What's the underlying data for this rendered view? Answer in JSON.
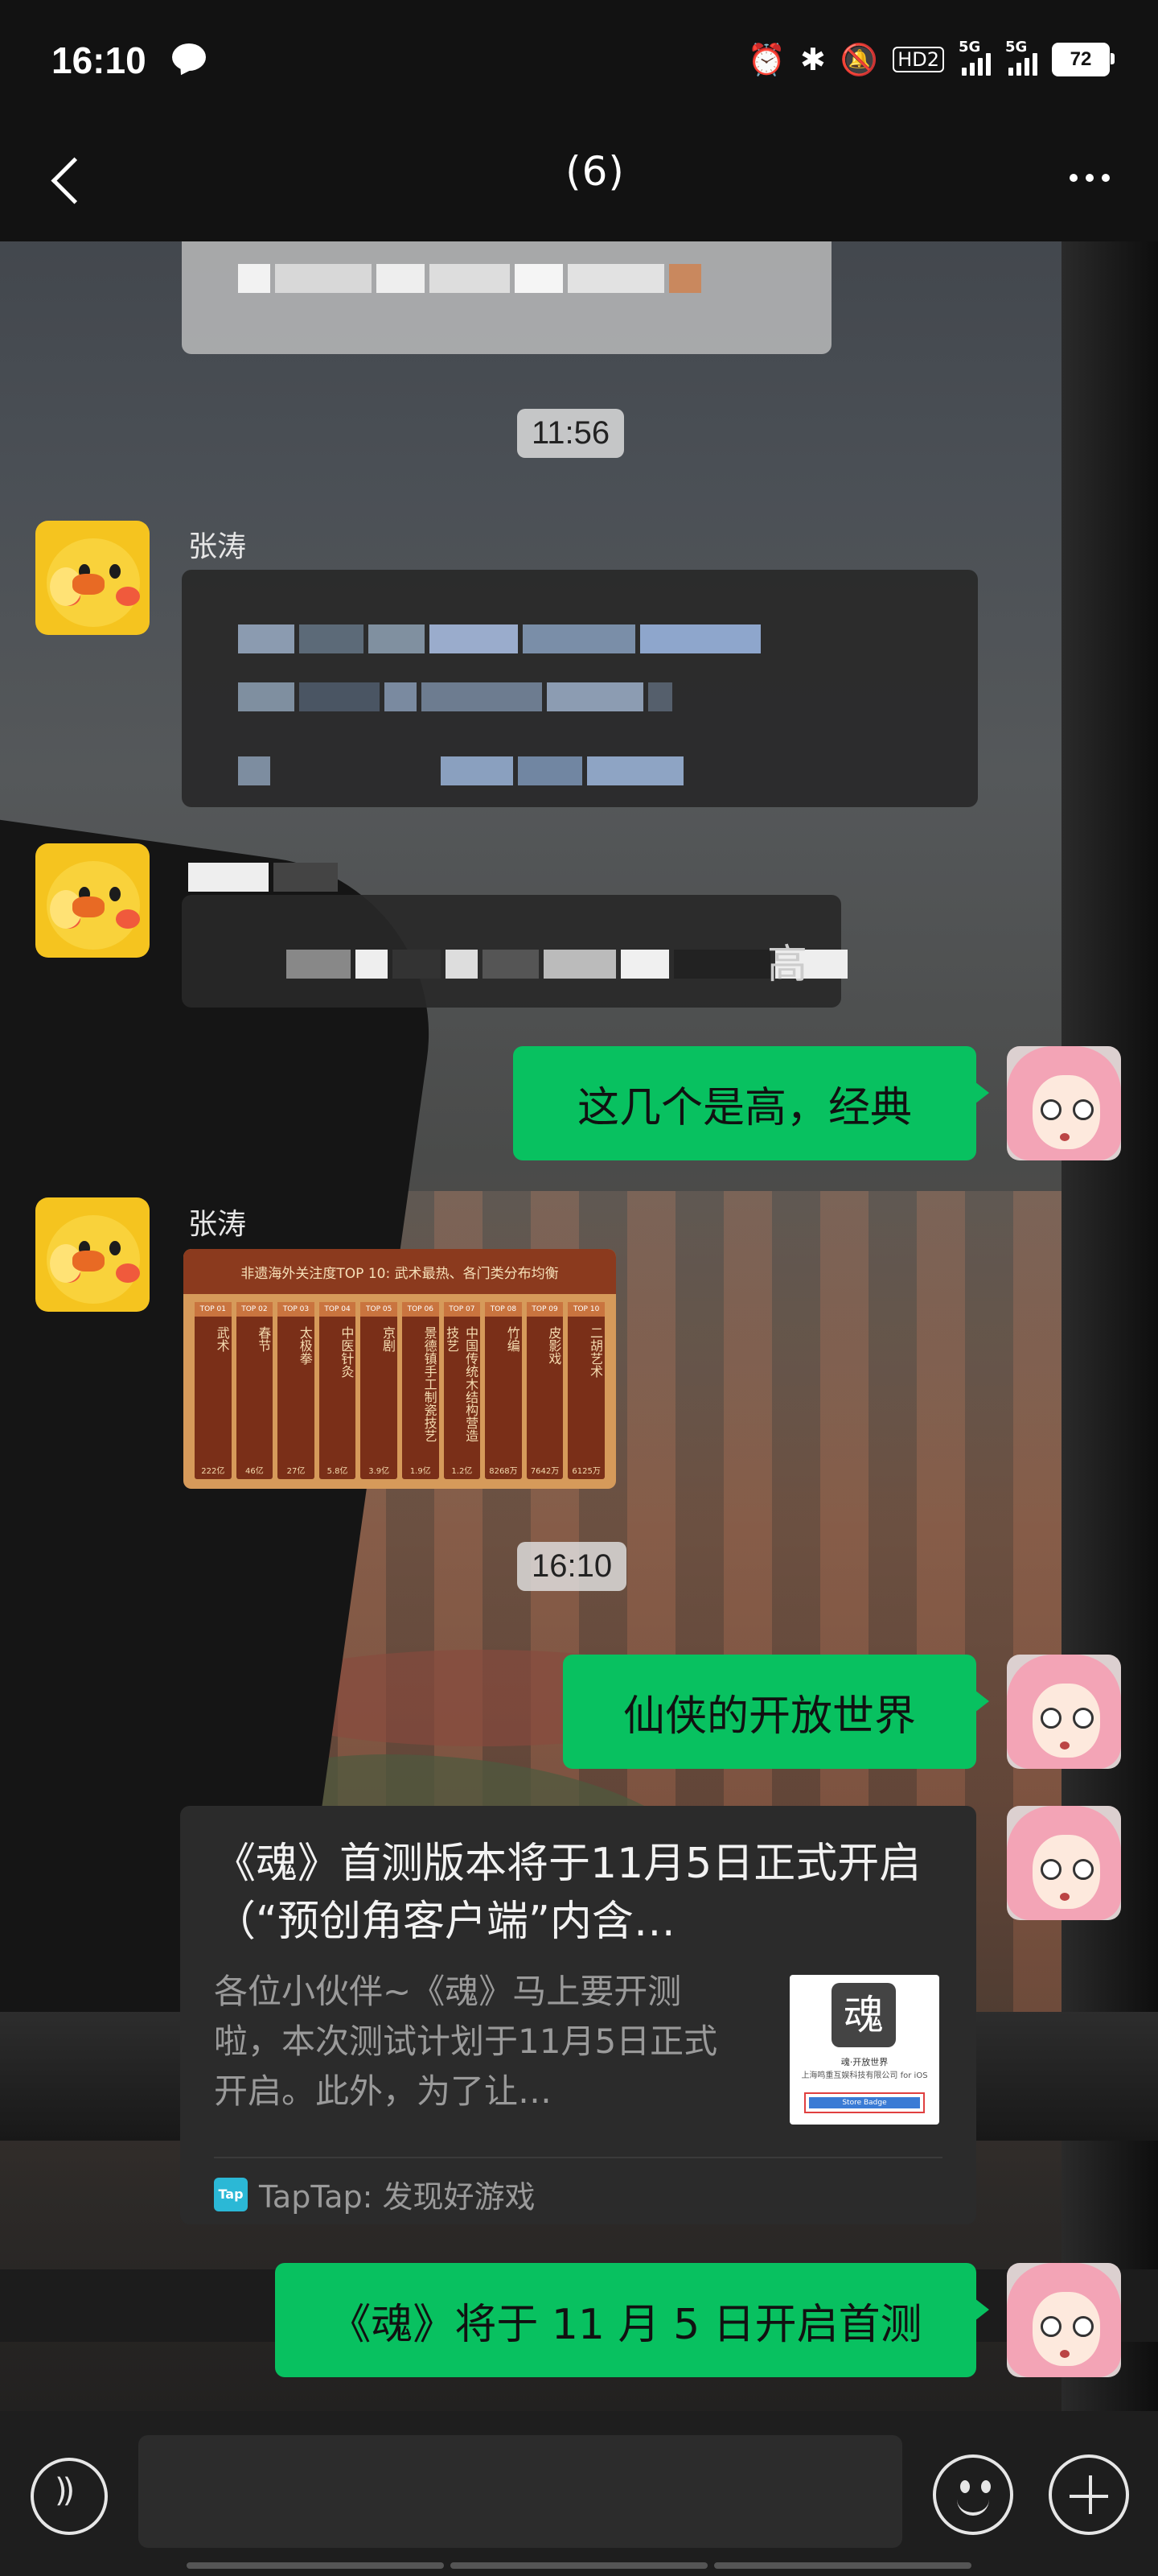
{
  "status": {
    "time": "16:10",
    "battery": "72",
    "signal1_label": "5G",
    "signal2_label": "5G",
    "hd_label": "HD2"
  },
  "header": {
    "title_suffix": "(6)"
  },
  "messages": {
    "stamp1": "11:56",
    "sender1": "张涛",
    "blur_end_char": "高",
    "msg_me_1": "这几个是高，经典",
    "sender2": "张涛",
    "image_header": "非遗海外关注度TOP 10: 武术最热、各门类分布均衡",
    "image_items": [
      {
        "rank": "TOP 01",
        "name": "武术",
        "value": "222亿"
      },
      {
        "rank": "TOP 02",
        "name": "春节",
        "value": "46亿"
      },
      {
        "rank": "TOP 03",
        "name": "太极拳",
        "value": "27亿"
      },
      {
        "rank": "TOP 04",
        "name": "中医针灸",
        "value": "5.8亿"
      },
      {
        "rank": "TOP 05",
        "name": "京剧",
        "value": "3.9亿"
      },
      {
        "rank": "TOP 06",
        "name": "景德镇手工制瓷技艺",
        "value": "1.9亿"
      },
      {
        "rank": "TOP 07",
        "name": "中国传统木结构营造技艺",
        "value": "1.2亿"
      },
      {
        "rank": "TOP 08",
        "name": "竹编",
        "value": "8268万"
      },
      {
        "rank": "TOP 09",
        "name": "皮影戏",
        "value": "7642万"
      },
      {
        "rank": "TOP 10",
        "name": "二胡艺术",
        "value": "6125万"
      }
    ],
    "stamp2": "16:10",
    "msg_me_2": "仙侠的开放世界",
    "card": {
      "title": "《魂》首测版本将于11月5日正式开启（“预创角客户端”内含…",
      "desc": "各位小伙伴~《魂》马上要开测啦，本次测试计划于11月5日正式开启。此外，为了让…",
      "thumb_logo": "魂",
      "thumb_line1": "魂·开放世界",
      "thumb_line2": "上海鸣重互娱科技有限公司 for iOS",
      "thumb_button": "Store Badge",
      "source_icon": "Tap",
      "source": "TapTap: 发现好游戏"
    },
    "msg_me_3": "《魂》将于 11 月 5 日开启首测"
  },
  "input": {
    "placeholder": ""
  },
  "icons": {
    "back": "chevron-left-icon",
    "more": "more-dots-icon",
    "voice": "voice-icon",
    "emoji": "emoji-icon",
    "plus": "plus-icon"
  },
  "colors": {
    "bubble_self": "#08c160",
    "bar_bg": "#121212"
  }
}
